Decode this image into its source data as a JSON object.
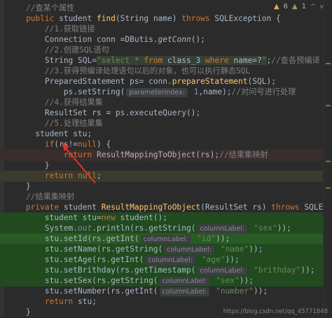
{
  "status": {
    "warnings": "6",
    "weak_warnings": "1",
    "extra": "^"
  },
  "watermark": "https://blog.csdn.net/qq_45771848",
  "lines": [
    {
      "t": [
        [
          "cm",
          "    //查某个属性"
        ]
      ]
    },
    {
      "t": [
        [
          "kw",
          "    public "
        ],
        [
          "",
          "student "
        ],
        [
          "fn",
          "find"
        ],
        [
          "",
          "(String name) "
        ],
        [
          "kw",
          "throws "
        ],
        [
          "",
          "SQLException {"
        ]
      ]
    },
    {
      "t": [
        [
          "cm",
          "        //1.获取链接"
        ]
      ]
    },
    {
      "t": [
        [
          "",
          "        Connection conn =DButis."
        ],
        [
          "static",
          "getConn"
        ],
        [
          "",
          "();"
        ]
      ]
    },
    {
      "t": [
        [
          "cm",
          "        //2.创建SQL语句"
        ]
      ]
    },
    {
      "t": [
        [
          "",
          "        String SQL="
        ],
        [
          "str sql",
          "\"select "
        ],
        [
          "sqlkw sql",
          "* "
        ],
        [
          "sqlkw sql",
          "from "
        ],
        [
          "sqltxt sql",
          "class_3 "
        ],
        [
          "sqlkw sql",
          "where "
        ],
        [
          "sqltxt sql",
          "name=?"
        ],
        [
          "str sql",
          "\""
        ],
        [
          "",
          ";"
        ],
        [
          "cm",
          "//查各预编译"
        ]
      ]
    },
    {
      "t": [
        [
          "cm",
          "        //3.获得预编译处理语句以后的对象，也可以执行静态SQL"
        ]
      ]
    },
    {
      "t": [
        [
          "",
          "        PreparedStatement ps= conn."
        ],
        [
          "fn",
          "prepareStatement"
        ],
        [
          "",
          "(SQL);"
        ]
      ]
    },
    {
      "t": [
        [
          "",
          "            ps.setString("
        ],
        [
          "hint",
          "parameterIndex:"
        ],
        [
          "num",
          " 1"
        ],
        [
          "",
          ",name);"
        ],
        [
          "cm",
          "//对问号进行处理"
        ]
      ]
    },
    {
      "t": [
        [
          "cm",
          "        //4.获得结果集"
        ]
      ]
    },
    {
      "t": [
        [
          "",
          "        ResultSet rs = ps.executeQuery();"
        ]
      ]
    },
    {
      "t": [
        [
          "cm",
          "        //5.处理结果集"
        ]
      ]
    },
    {
      "t": [
        [
          "",
          "      student stu;"
        ]
      ]
    },
    {
      "t": [
        [
          "kw",
          "        if"
        ],
        [
          "",
          "(rs!="
        ],
        [
          "kw",
          "null"
        ],
        [
          "",
          ") {"
        ]
      ]
    },
    {
      "t": [
        [
          "kw",
          "            return "
        ],
        [
          "",
          "ResultMappingToObject(rs);"
        ],
        [
          "cm",
          "//结果集映射"
        ]
      ],
      "cls": "red-tint"
    },
    {
      "t": [
        [
          "",
          "        }"
        ]
      ]
    },
    {
      "t": [
        [
          "kw",
          "        return null"
        ],
        [
          "",
          ";"
        ]
      ],
      "cls": "highlight"
    },
    {
      "t": [
        [
          "",
          "    }"
        ]
      ]
    },
    {
      "t": [
        [
          "cm",
          "    //结果集映射"
        ]
      ]
    },
    {
      "t": [
        [
          "kw",
          "    private "
        ],
        [
          "",
          "student "
        ],
        [
          "fn",
          "ResultMappingToObject"
        ],
        [
          "",
          "(ResultSet rs) "
        ],
        [
          "kw",
          "throws "
        ],
        [
          "",
          "SQLException {"
        ]
      ]
    },
    {
      "t": [
        [
          "",
          "        student stu="
        ],
        [
          "kw",
          "new "
        ],
        [
          "",
          "student();"
        ]
      ],
      "cls": "green"
    },
    {
      "t": [
        [
          "",
          "        System."
        ],
        [
          "it",
          "out"
        ],
        [
          "",
          ".println(rs.getString("
        ],
        [
          "hint",
          "columnLabel:"
        ],
        [
          "str",
          " \"sex\""
        ],
        [
          "",
          "));"
        ]
      ],
      "cls": "green"
    },
    {
      "t": [
        [
          "",
          "        stu.setId(rs.getInt("
        ],
        [
          "hint",
          "columnLabel:"
        ],
        [
          "str",
          " \"id\""
        ],
        [
          "",
          "));"
        ]
      ],
      "cls": "green-strong"
    },
    {
      "t": [
        [
          "",
          "        stu.setName(rs.getString("
        ],
        [
          "hint",
          "columnLabel:"
        ],
        [
          "str",
          " \"name\""
        ],
        [
          "",
          "));"
        ]
      ],
      "cls": "green"
    },
    {
      "t": [
        [
          "",
          "        stu.setAge(rs.getInt("
        ],
        [
          "hint",
          "columnLabel:"
        ],
        [
          "str",
          " \"age\""
        ],
        [
          "",
          "));"
        ]
      ],
      "cls": "green"
    },
    {
      "t": [
        [
          "",
          "        stu.setBrithday(rs.getTimestamp("
        ],
        [
          "hint",
          "columnLabel:"
        ],
        [
          "str",
          " \"brithday\""
        ],
        [
          "",
          "));"
        ]
      ],
      "cls": "green"
    },
    {
      "t": [
        [
          "",
          "        stu.setSex(rs.getString("
        ],
        [
          "hint",
          "columnLabel:"
        ],
        [
          "str",
          " \"sex\""
        ],
        [
          "",
          "));"
        ]
      ],
      "cls": "green"
    },
    {
      "t": [
        [
          "",
          "        stu.setNumber(rs.getInt("
        ],
        [
          "hint",
          "columnLabel:"
        ],
        [
          "str",
          " \"number\""
        ],
        [
          "",
          "));"
        ]
      ]
    },
    {
      "t": [
        [
          "kw",
          "        return "
        ],
        [
          "",
          "stu;"
        ]
      ]
    },
    {
      "t": [
        [
          "",
          "    }"
        ]
      ]
    }
  ]
}
